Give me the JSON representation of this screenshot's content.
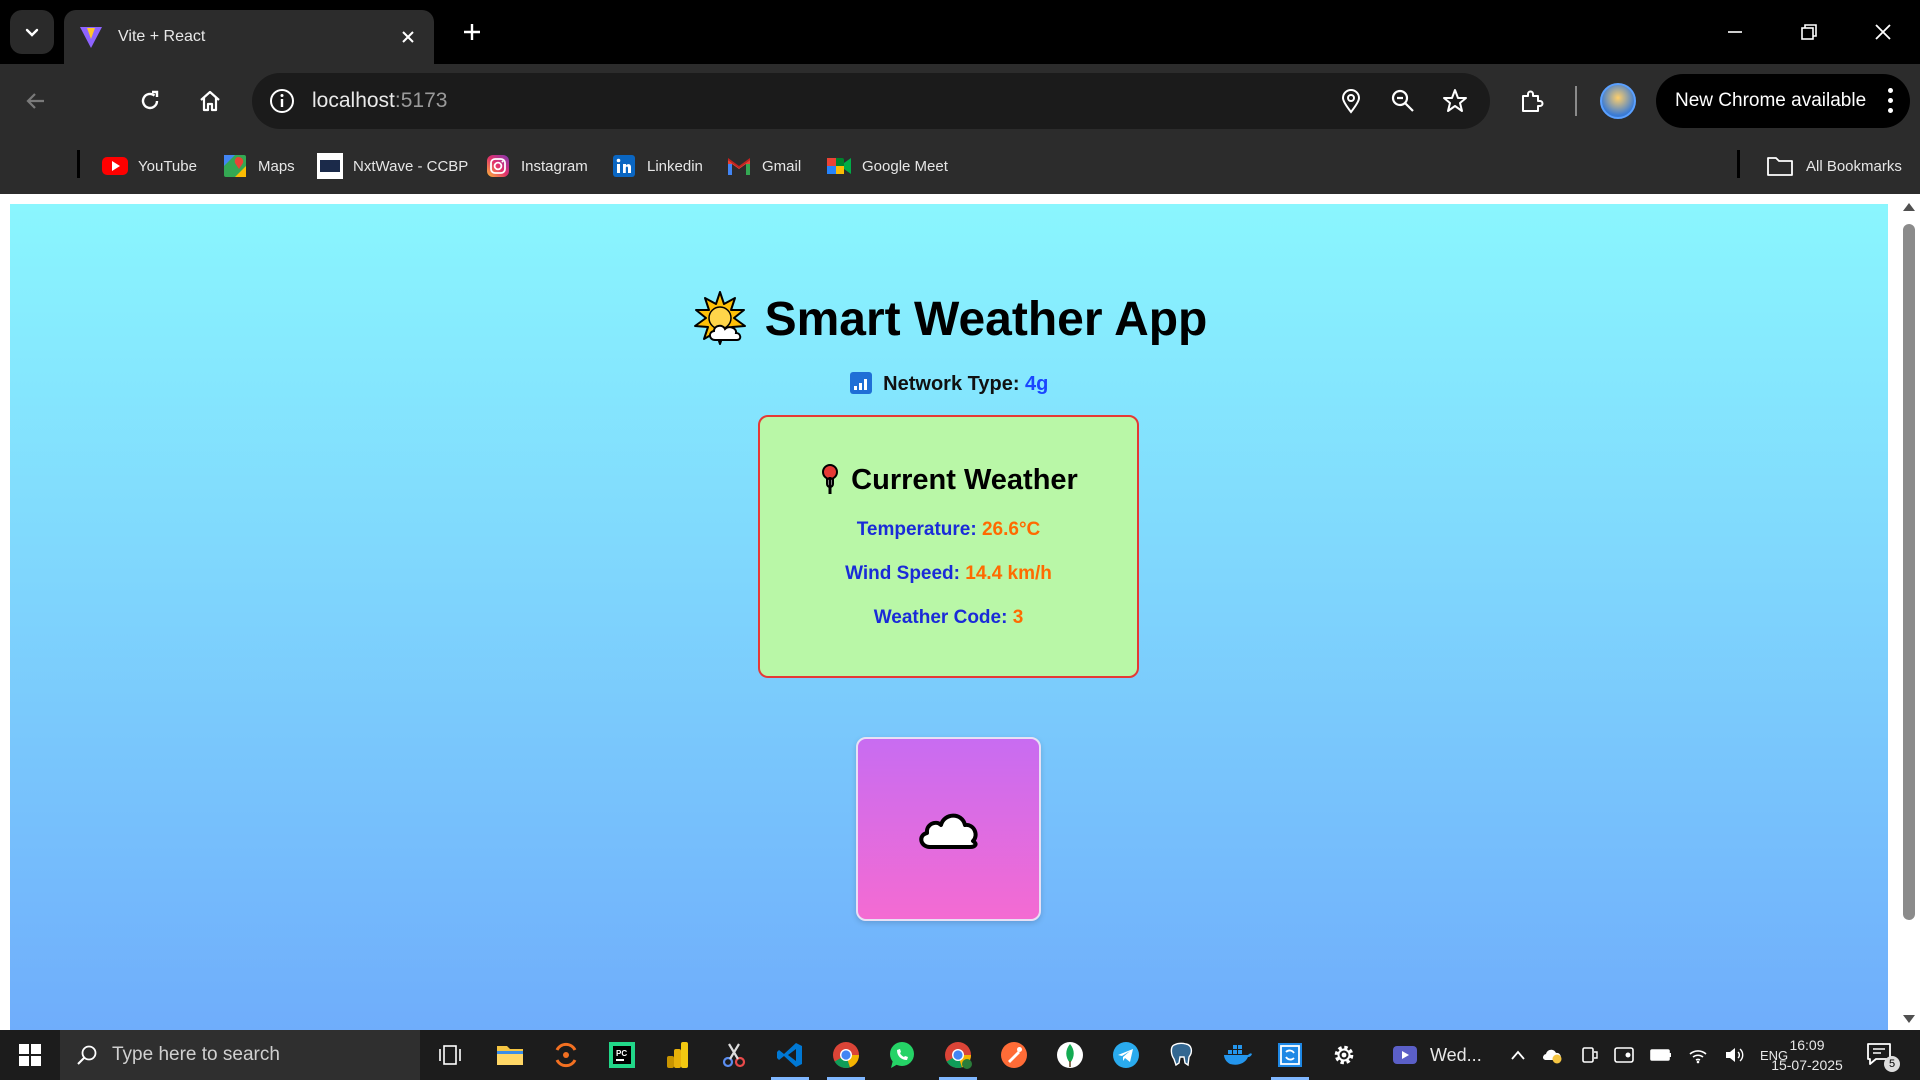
{
  "browser": {
    "tab_title": "Vite + React",
    "url_host": "localhost",
    "url_port": ":5173",
    "update_label": "New Chrome available"
  },
  "bookmarks": [
    {
      "label": "YouTube",
      "icon": "youtube-icon"
    },
    {
      "label": "Maps",
      "icon": "maps-icon"
    },
    {
      "label": "NxtWave - CCBP",
      "icon": "nxtwave-icon"
    },
    {
      "label": "Instagram",
      "icon": "instagram-icon"
    },
    {
      "label": "Linkedin",
      "icon": "linkedin-icon"
    },
    {
      "label": "Gmail",
      "icon": "gmail-icon"
    },
    {
      "label": "Google Meet",
      "icon": "google-meet-icon"
    }
  ],
  "all_bookmarks_label": "All Bookmarks",
  "app": {
    "title": "Smart Weather App",
    "network_label": "Network Type:",
    "network_value": "4g",
    "card_title": "Current Weather",
    "temperature_label": "Temperature:",
    "temperature_value": "26.6°C",
    "wind_label": "Wind Speed:",
    "wind_value": "14.4 km/h",
    "code_label": "Weather Code:",
    "code_value": "3"
  },
  "colors": {
    "page_top": "#8af6fe",
    "page_bottom": "#6fadfb",
    "card_bg": "#b9f7a7",
    "card_border": "#e53935",
    "label_blue": "#1a2bd8",
    "value_orange": "#ff6a00"
  },
  "taskbar": {
    "search_placeholder": "Type here to search",
    "pinned_app_label": "Wed...",
    "language": "ENG",
    "time": "16:09",
    "date": "15-07-2025",
    "notification_count": "5"
  }
}
